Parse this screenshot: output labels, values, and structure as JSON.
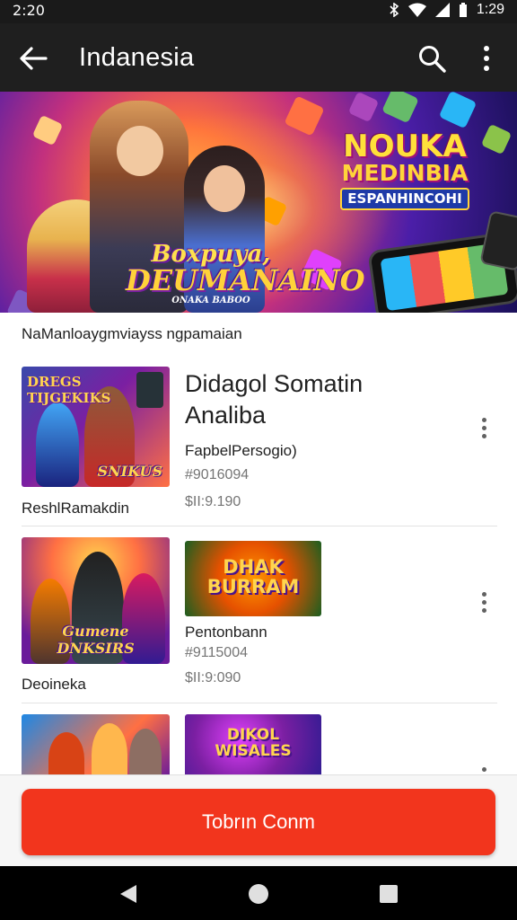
{
  "status_bar": {
    "time": "2:20",
    "clock": "1:29",
    "icons": [
      "bluetooth-icon",
      "wifi-icon",
      "cellular-icon",
      "battery-icon"
    ]
  },
  "app_bar": {
    "title": "Indanesia",
    "icons": [
      "back-arrow-icon",
      "search-icon",
      "more-vert-icon"
    ]
  },
  "banner": {
    "logo_left_line1": "Boxpuya,",
    "logo_left_line2": "DEUMANAINO",
    "logo_left_line3": "ONAKA BABOO",
    "logo_right_line1": "NOUKA",
    "logo_right_line2": "MEDINBIA",
    "logo_right_line3": "ESPANHINCOHI"
  },
  "section": {
    "title": "NaManloaygmviayss ngpamaian"
  },
  "items": [
    {
      "thumb_text": "DREGS TIJGEKIKS",
      "thumb_bottom": "SNIKUS",
      "caption": "ReshlRamakdin",
      "name": "Didagol Somatin Analiba",
      "subtitle": "FapbelPersogio)",
      "code": "#9016094",
      "price": "$II:9.190"
    },
    {
      "thumb_text": "",
      "thumb_bottom": "Gumene DNKSIRS",
      "thumb2_text_line1": "DHAK",
      "thumb2_text_line2": "BURRAM",
      "caption": "Deoineka",
      "subtitle": "Pentonbann",
      "code": "#9115004",
      "price": "$II:9:090"
    },
    {
      "thumb2_text_line1": "DIKOL",
      "thumb2_text_line2": "WISALES"
    }
  ],
  "cta": {
    "label": "Tobrın Conm"
  },
  "nav": {
    "icons": [
      "back-triangle-icon",
      "home-circle-icon",
      "recents-square-icon"
    ]
  },
  "colors": {
    "accent": "#f2351d",
    "app_bar": "#1f1f1f",
    "status_bar": "#1a1a1a"
  }
}
